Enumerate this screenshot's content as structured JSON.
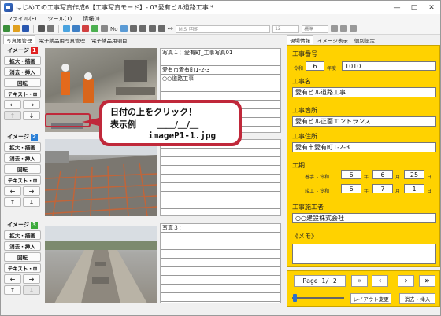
{
  "window": {
    "title": "はじめての工事写真作成6【工事写真モード】- 03愛有ビル道路工事 *",
    "controls": [
      "—",
      "□",
      "✕"
    ]
  },
  "menu": [
    "ファイル(F)",
    "ツール(T)",
    "情報(I)"
  ],
  "toolbar": {
    "font_name": "ＭＳ 明朝",
    "font_size": "12",
    "font_style": "標準",
    "no_label": "No"
  },
  "left_tabs": [
    "写真帳管理",
    "電子納品用写真管理",
    "電子納品用項目"
  ],
  "right_tabs": [
    "現場情報",
    "イメージ表示",
    "個別設定"
  ],
  "image_blocks": [
    {
      "label": "イメージ",
      "num": "1",
      "num_color": "#e02020"
    },
    {
      "label": "イメージ",
      "num": "2",
      "num_color": "#2a7fd6"
    },
    {
      "label": "イメージ",
      "num": "3",
      "num_color": "#3aaa3a"
    }
  ],
  "image_buttons": {
    "enlarge": "拡大・描画",
    "erase_insert": "消去・挿入",
    "rotate": "回転",
    "text": "テキスト・⊠"
  },
  "text_areas": [
    {
      "lines": [
        "写真１：愛有町_工事写真01",
        "",
        "愛有市愛有町1-2-3",
        "○○道路工事",
        "",
        "",
        "",
        "",
        "",
        "",
        "",
        ""
      ]
    },
    {
      "lines": [
        "",
        "",
        "",
        "",
        "",
        "",
        "",
        "",
        "",
        "",
        ""
      ]
    },
    {
      "lines": [
        "写真３：",
        "",
        "",
        "",
        "",
        "",
        "",
        "",
        "",
        "",
        ""
      ]
    }
  ],
  "site_info": {
    "number_label": "工事番号",
    "era": "令和",
    "year": "6",
    "year_suffix": "年度",
    "number": "1010",
    "name_label": "工事名",
    "name": "愛有ビル道路工事",
    "location_label": "工事箇所",
    "location": "愛有ビル正面エントランス",
    "place_label": "工事住所",
    "place": "愛有市愛有町1-2-3",
    "period_label": "工期",
    "start_label": "着手",
    "end_label": "竣工",
    "era_prefix": "- 令和",
    "start": {
      "year": "6",
      "month": "6",
      "day": "25"
    },
    "end": {
      "year": "6",
      "month": "7",
      "day": "1"
    },
    "unit_year": "年",
    "unit_month": "月",
    "unit_day": "日",
    "contractor_label": "工事施工者",
    "contractor": "○○建設株式会社",
    "memo_label": "《メモ》",
    "memo": ""
  },
  "pager": {
    "page_text": "Page 1/ 2",
    "first": "«",
    "prev": "‹",
    "next": "›",
    "last": "»",
    "layout_button": "レイアウト変更",
    "erase_insert_button": "消去・挿入"
  },
  "callout": {
    "line1": "日付の上をクリック！",
    "line2_label": "表示例",
    "line2_value": "＿＿/＿/＿",
    "line3": "imageP1-1.jpg"
  }
}
